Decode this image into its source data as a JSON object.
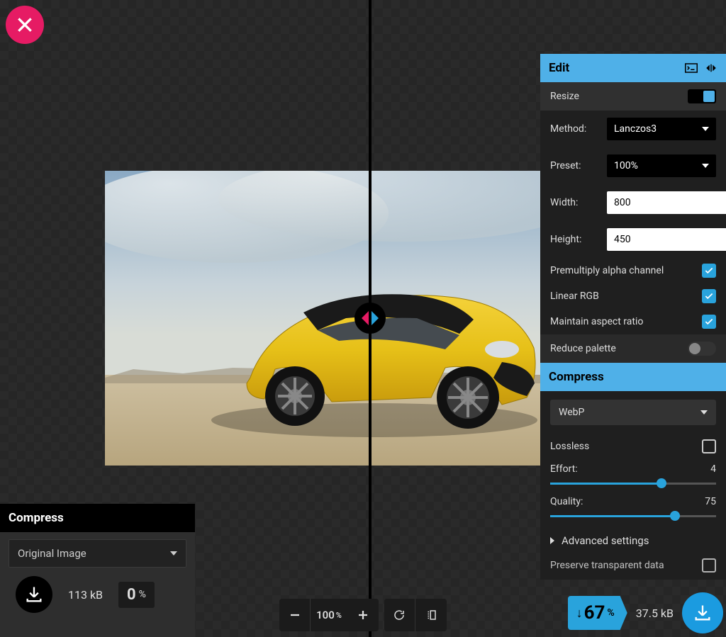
{
  "left": {
    "header": "Compress",
    "format_selected": "Original Image",
    "file_size": "113 kB",
    "reduction_pct": "0",
    "reduction_unit": "%"
  },
  "bottom": {
    "zoom_value": "100",
    "zoom_unit": "%"
  },
  "right": {
    "edit_header": "Edit",
    "resize_label": "Resize",
    "method_label": "Method:",
    "method_value": "Lanczos3",
    "preset_label": "Preset:",
    "preset_value": "100%",
    "width_label": "Width:",
    "width_value": "800",
    "height_label": "Height:",
    "height_value": "450",
    "premultiply_label": "Premultiply alpha channel",
    "linear_rgb_label": "Linear RGB",
    "maintain_ar_label": "Maintain aspect ratio",
    "reduce_palette_label": "Reduce palette",
    "compress_header": "Compress",
    "format_value": "WebP",
    "lossless_label": "Lossless",
    "effort_label": "Effort:",
    "effort_value": "4",
    "quality_label": "Quality:",
    "quality_value": "75",
    "advanced_label": "Advanced settings",
    "preserve_label": "Preserve transparent data",
    "reduction_pct": "67",
    "reduction_unit": "%",
    "out_size": "37.5 kB"
  }
}
